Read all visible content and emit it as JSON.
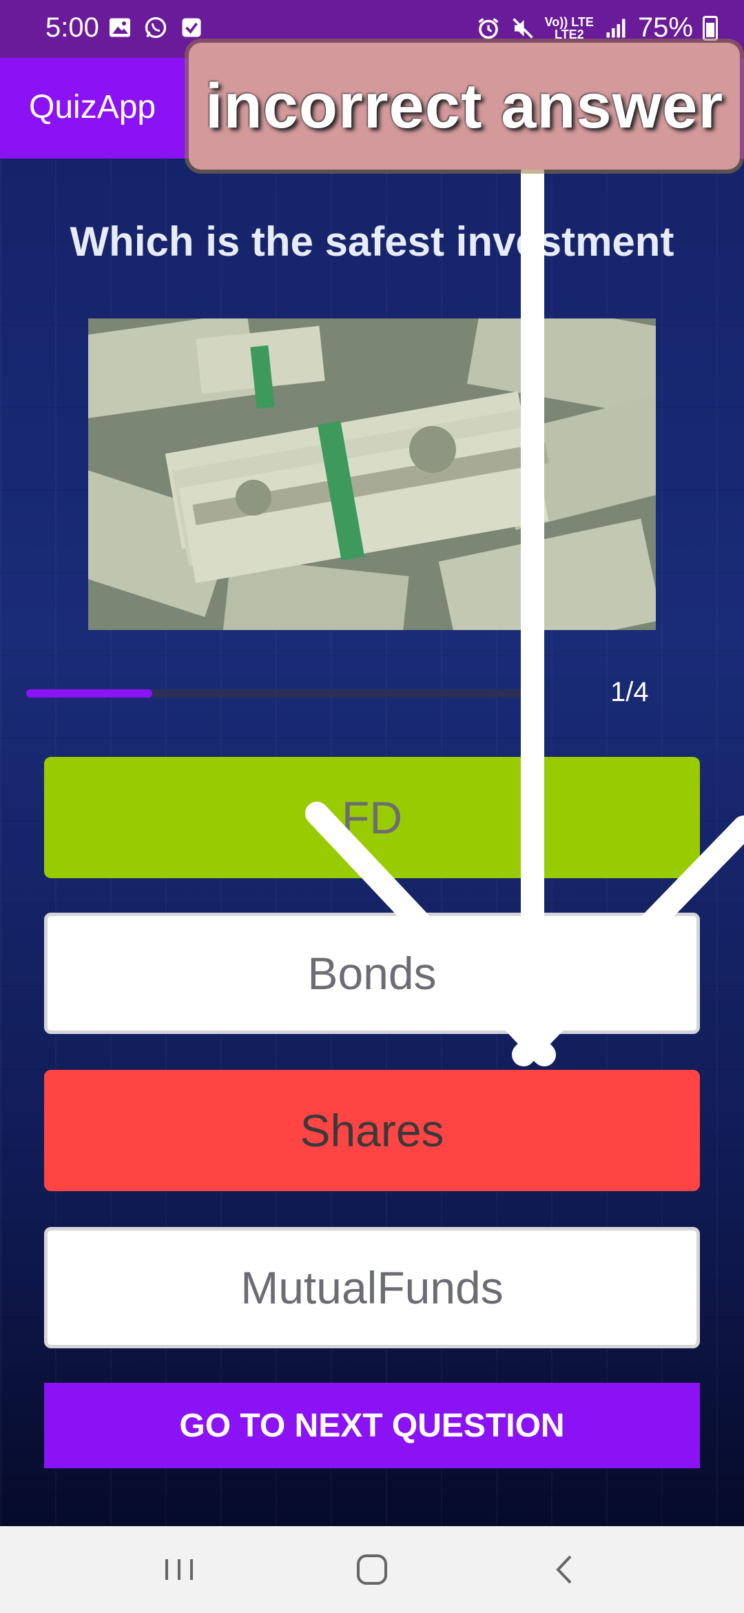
{
  "status_bar": {
    "time": "5:00",
    "network_top": "Vo)) LTE",
    "network_bottom": "LTE2",
    "battery": "75%",
    "icons_left": [
      "gallery-icon",
      "whatsapp-icon",
      "checkbox-icon"
    ],
    "icons_right": [
      "alarm-icon",
      "mute-icon",
      "signal-icon",
      "battery-icon"
    ]
  },
  "app_bar": {
    "title": "QuizApp"
  },
  "toast": {
    "text": "incorrect answer"
  },
  "question": {
    "text": "Which is the safest investment",
    "image": "money-stacks-image"
  },
  "progress": {
    "current": 1,
    "total": 4,
    "label": "1/4",
    "fraction": 0.25
  },
  "options": [
    {
      "label": "FD",
      "state": "correct",
      "color": "#99cc00"
    },
    {
      "label": "Bonds",
      "state": "default",
      "color": "#ffffff"
    },
    {
      "label": "Shares",
      "state": "wrong",
      "color": "#ff4444"
    },
    {
      "label": "MutualFunds",
      "state": "default",
      "color": "#ffffff"
    }
  ],
  "next_button": {
    "label": "GO TO NEXT QUESTION"
  },
  "colors": {
    "status_bar": "#6a1b9a",
    "accent": "#8a12f5",
    "correct": "#99cc00",
    "wrong": "#ff4444",
    "toast_bg": "#d3999b"
  },
  "nav_bar": {
    "buttons": [
      "recents-icon",
      "home-icon",
      "back-icon"
    ]
  }
}
